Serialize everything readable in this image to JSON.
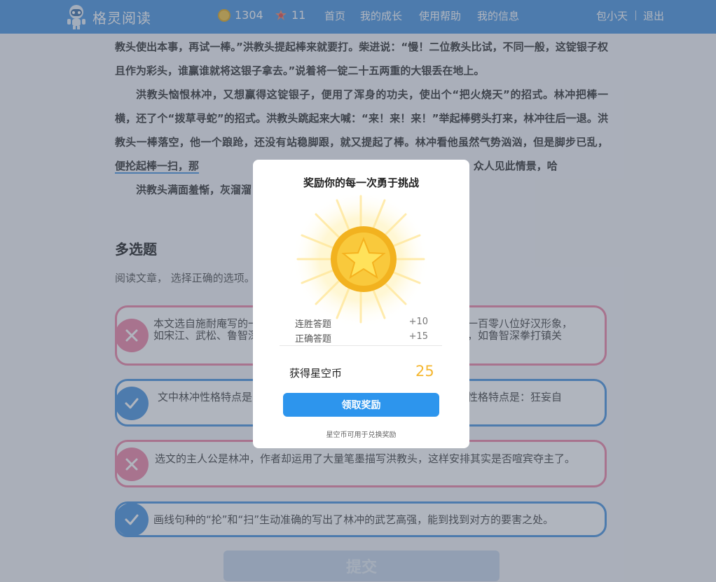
{
  "header": {
    "app_name": "格灵阅读",
    "coins": "1304",
    "gems": "11",
    "nav": [
      "首页",
      "我的成长",
      "使用帮助",
      "我的信息"
    ],
    "username": "包小天",
    "logout": "退出"
  },
  "article": {
    "p1": "教头使出本事，再试一棒。”洪教头提起棒来就要打。柴进说：“慢！二位教头比试，不同一般，这锭银子权且作为彩头，谁赢谁就将这银子拿去。”说着将一锭二十五两重的大银丢在地上。",
    "p2_a": "洪教头恼恨林冲，又想赢得这锭银子，便用了浑身的功夫，使出个“把火烧天”的招式。林冲把棒一横，还了个“拨草寻蛇”的招式。洪教头跳起来大喊：“来！来！来！”举起棒劈头打来，林冲往后一退。洪教头一棒落空，他一个踉跄，还没有站稳脚跟，就又提起了棒。林冲看他虽然气势汹汹，但是脚步已乱，",
    "p2_underline": "便抡起棒一扫，那",
    "p2_b": "“扑”的一声倒在地上，棒也甩出老远。众人见此情景，哈",
    "p3": "洪教头满面羞惭，灰溜溜"
  },
  "section": {
    "title": "多选题",
    "instruction": "阅读文章， 选择正确的选项。"
  },
  "options": [
    {
      "left": "本文选自施耐庵写的一",
      "right": "一百零八位好汉形象，",
      "line2_left": "如宋江、武松、鲁智深",
      "line2_right": "，如鲁智深拳打镇关",
      "status": "wrong"
    },
    {
      "left": "文中林冲性格特点是",
      "right": "性格特点是：狂妄自",
      "status": "right"
    },
    {
      "text": "选文的主人公是林冲，作者却运用了大量笔墨描写洪教头，这样安排其实是否喧宾夺主了。",
      "status": "wrong"
    },
    {
      "text": "画线句种的“抡”和“扫”生动准确的写出了林冲的武艺高强，能到找到对方的要害之处。",
      "status": "right"
    }
  ],
  "submit_label": "提交",
  "modal": {
    "title": "奖励你的每一次勇于挑战",
    "rows": [
      {
        "label": "连胜答题",
        "value": "+10"
      },
      {
        "label": "正确答题",
        "value": "+15"
      }
    ],
    "earn_label": "获得星空币",
    "earn_value": "25",
    "claim_label": "领取奖励",
    "note": "星空币可用于兑换奖励"
  },
  "colors": {
    "header_bg": "#4c95e0",
    "accent": "#2d95ed",
    "wrong": "#f088a8",
    "right": "#4c95e0",
    "coin_value": "#f5b731"
  }
}
